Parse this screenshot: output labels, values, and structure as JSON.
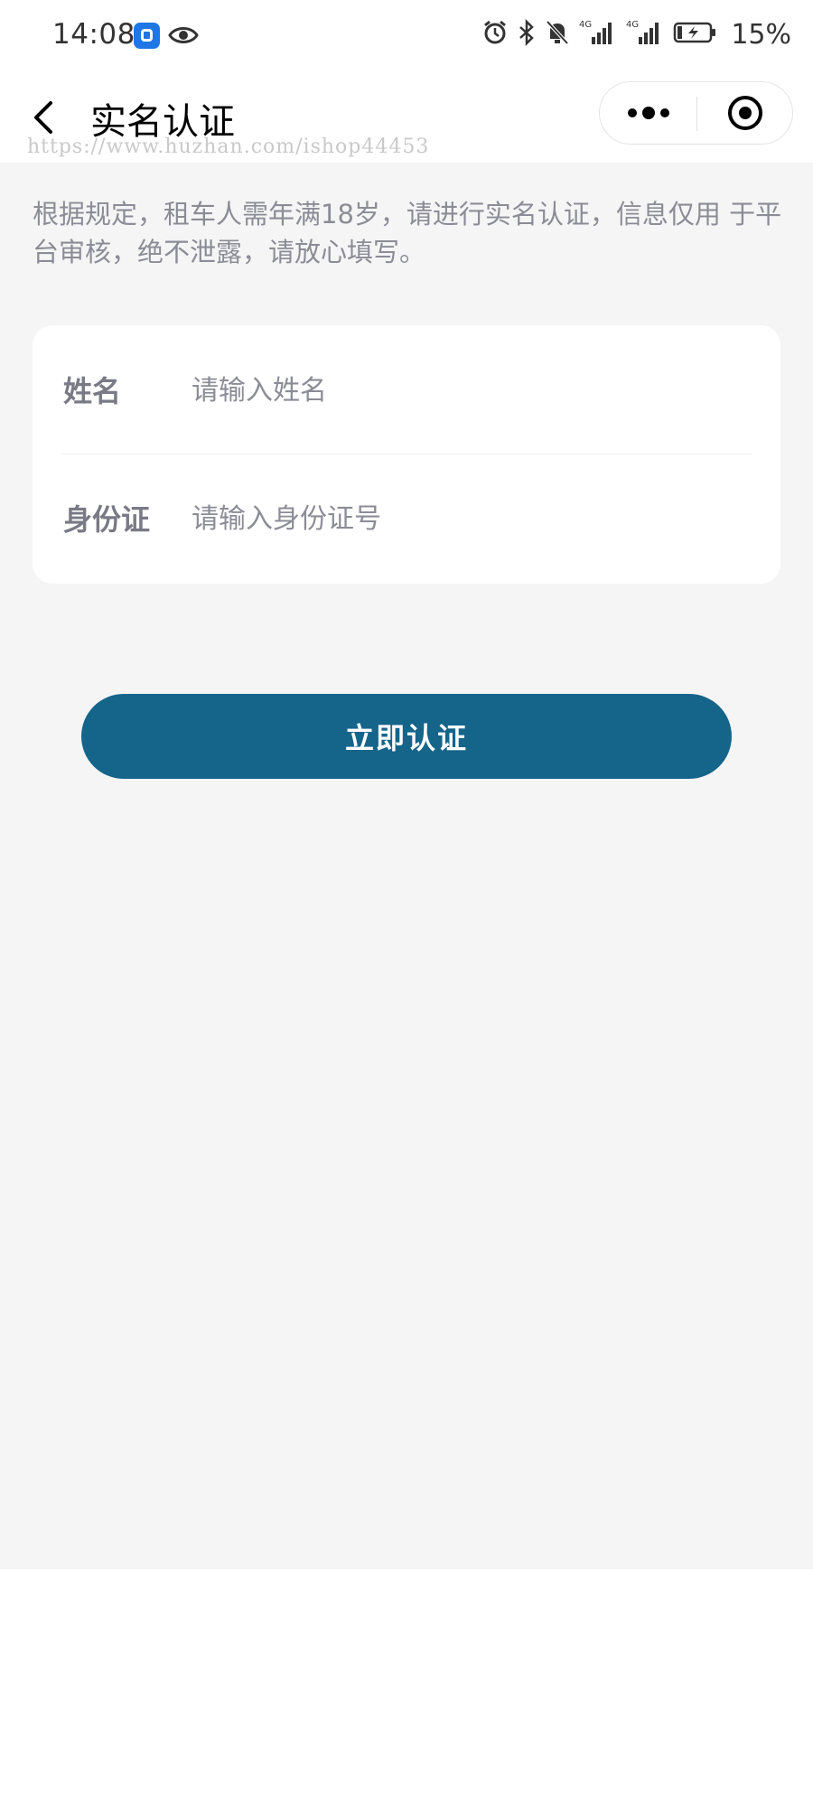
{
  "status_bar": {
    "time": "14:08",
    "battery_percent": "15%",
    "network_1": "4G",
    "network_2": "4G",
    "app_notification_icon": "shield-app-icon",
    "icons": [
      "eye-icon",
      "alarm-icon",
      "bluetooth-icon",
      "mute-bell-icon",
      "signal-icon",
      "battery-charging-icon"
    ]
  },
  "nav": {
    "title": "实名认证",
    "watermark": "https://www.huzhan.com/ishop44453"
  },
  "notice": "根据规定，租车人需年满18岁，请进行实名认证，信息仅用 于平台审核，绝不泄露，请放心填写。",
  "form": {
    "name": {
      "label": "姓名",
      "placeholder": "请输入姓名",
      "value": ""
    },
    "id_card": {
      "label": "身份证",
      "placeholder": "请输入身份证号",
      "value": ""
    }
  },
  "submit_label": "立即认证",
  "colors": {
    "primary": "#15648a",
    "page_bg": "#f5f5f6",
    "muted_text": "#8c8c96"
  }
}
